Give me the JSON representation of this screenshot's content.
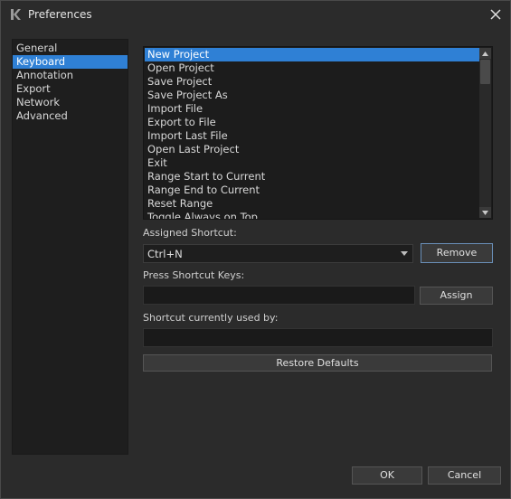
{
  "window": {
    "title": "Preferences"
  },
  "categories": [
    {
      "label": "General",
      "selected": false
    },
    {
      "label": "Keyboard",
      "selected": true
    },
    {
      "label": "Annotation",
      "selected": false
    },
    {
      "label": "Export",
      "selected": false
    },
    {
      "label": "Network",
      "selected": false
    },
    {
      "label": "Advanced",
      "selected": false
    }
  ],
  "commands": [
    {
      "label": "New Project",
      "selected": true
    },
    {
      "label": "Open Project",
      "selected": false
    },
    {
      "label": "Save Project",
      "selected": false
    },
    {
      "label": "Save Project As",
      "selected": false
    },
    {
      "label": "Import File",
      "selected": false
    },
    {
      "label": "Export to File",
      "selected": false
    },
    {
      "label": "Import Last File",
      "selected": false
    },
    {
      "label": "Open Last Project",
      "selected": false
    },
    {
      "label": "Exit",
      "selected": false
    },
    {
      "label": "Range Start to Current",
      "selected": false
    },
    {
      "label": "Range End to Current",
      "selected": false
    },
    {
      "label": "Reset Range",
      "selected": false
    },
    {
      "label": "Toggle Always on Top",
      "selected": false
    }
  ],
  "shortcut": {
    "assigned_label": "Assigned Shortcut:",
    "assigned_value": "Ctrl+N",
    "remove_label": "Remove",
    "press_label": "Press Shortcut Keys:",
    "press_value": "",
    "assign_label": "Assign",
    "used_by_label": "Shortcut currently used by:",
    "used_by_value": "",
    "restore_label": "Restore Defaults"
  },
  "footer": {
    "ok_label": "OK",
    "cancel_label": "Cancel"
  },
  "colors": {
    "selection": "#2f80d5",
    "background": "#2b2b2b"
  }
}
